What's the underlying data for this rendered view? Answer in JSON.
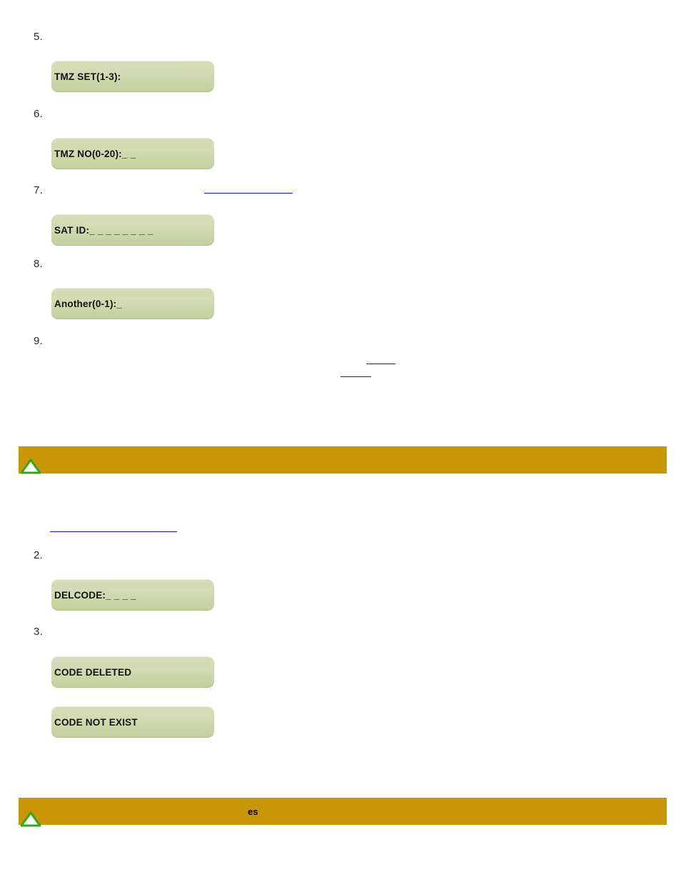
{
  "document": {
    "type": "manual-page",
    "background_color": "#ffffff"
  },
  "colors": {
    "lcd_face": "#d3dbb4",
    "lcd_face_bottom": "#c3cf9e",
    "lcd_text": "#121212",
    "banner": "#c9960a",
    "link": "#1414c8",
    "marker_text": "#2b2b2b",
    "triangle_fill": "#ffffff",
    "triangle_stroke": "#2fa81e"
  },
  "steps_upper": [
    {
      "number": "5."
    },
    {
      "number": "6."
    },
    {
      "number": "7."
    },
    {
      "number": "8."
    },
    {
      "number": "9."
    }
  ],
  "steps_lower": [
    {
      "number": "2."
    },
    {
      "number": "3."
    }
  ],
  "lcd_screens": [
    {
      "id": "tmz-set",
      "text": "TMZ SET(1-3):"
    },
    {
      "id": "tmz-no",
      "text": "TMZ NO(0-20):_ _"
    },
    {
      "id": "sat-id",
      "text": "SAT ID:_ _ _ _ _ _ _ _"
    },
    {
      "id": "another",
      "text": "Another(0-1):_"
    },
    {
      "id": "delcode",
      "text": "DELCODE:_ _ _ _"
    },
    {
      "id": "code-deleted",
      "text": "CODE DELETED"
    },
    {
      "id": "code-not-exist",
      "text": "CODE NOT EXIST"
    }
  ],
  "banners": [
    {
      "id": "banner-top",
      "text": ""
    },
    {
      "id": "banner-bottom",
      "text": "es"
    }
  ],
  "icons": {
    "triangle": "up-triangle-icon"
  }
}
